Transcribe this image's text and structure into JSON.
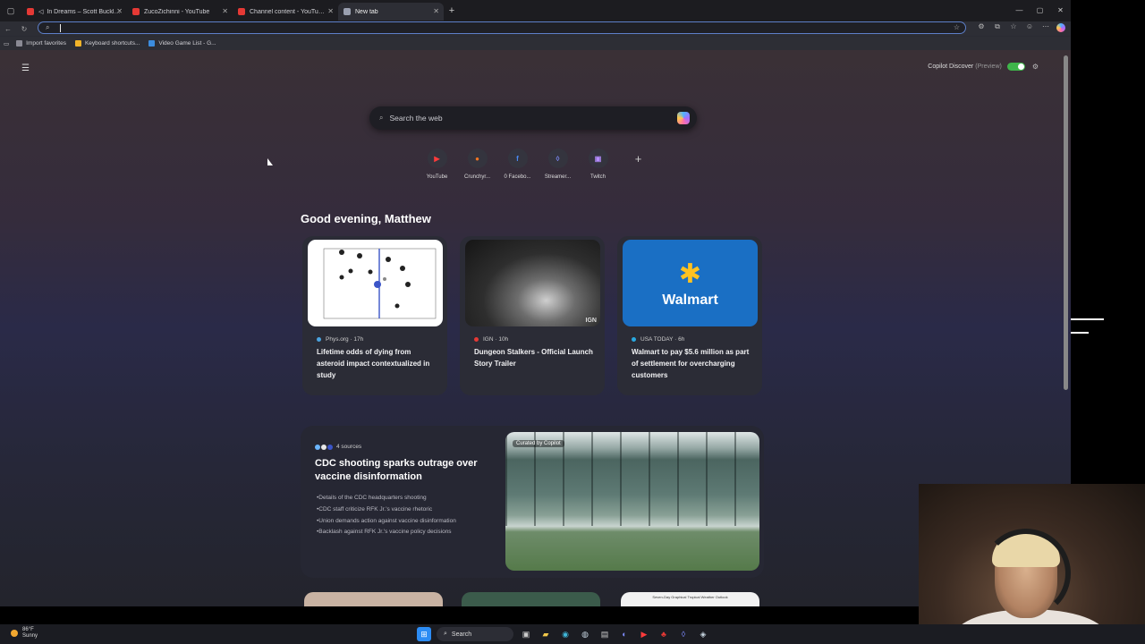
{
  "tabs": [
    {
      "label": "In Dreams – Scott Buckley (f",
      "color": "#e53935"
    },
    {
      "label": "ZucoZichinni - YouTube",
      "color": "#e53935"
    },
    {
      "label": "Channel content - YouTube Studio",
      "color": "#e53935"
    },
    {
      "label": "New tab",
      "color": "#9aa0b0"
    }
  ],
  "new_tab_symbol": "+",
  "bookmarks": [
    {
      "label": "Import favorites",
      "color": "#8a8a94"
    },
    {
      "label": "Keyboard shortcuts...",
      "color": "#f0b429"
    },
    {
      "label": "Video Game List - G...",
      "color": "#3c8dde"
    }
  ],
  "page": {
    "discover_label": "Copilot Discover",
    "discover_preview": "(Preview)",
    "search_placeholder": "Search the web",
    "greeting": "Good evening, Matthew"
  },
  "shortcuts": [
    {
      "label": "YouTube",
      "glyph": "▶",
      "color": "#ff3b3b"
    },
    {
      "label": "Crunchyr...",
      "glyph": "●",
      "color": "#f47521"
    },
    {
      "label": "0 Facebo...",
      "glyph": "f",
      "color": "#4b8cf7"
    },
    {
      "label": "Streamer...",
      "glyph": "◊",
      "color": "#7f8cff"
    },
    {
      "label": "Twitch",
      "glyph": "▣",
      "color": "#b58cff"
    }
  ],
  "cards": [
    {
      "source": "Phys.org · 17h",
      "title": "Lifetime odds of dying from asteroid impact contextualized in study",
      "dot": "#4aa3df"
    },
    {
      "source": "IGN · 10h",
      "title": "Dungeon Stalkers - Official Launch Story Trailer",
      "dot": "#e53935"
    },
    {
      "source": "USA TODAY · 6h",
      "title": "Walmart to pay $5.6 million as part of settlement for overcharging customers",
      "dot": "#29a8e0"
    }
  ],
  "walmart_logo_text": "Walmart",
  "feature": {
    "sources": "4 sources",
    "headline": "CDC shooting sparks outrage over vaccine disinformation",
    "curated": "Curated by Copilot",
    "bullets": [
      "•Details of the CDC headquarters shooting",
      "•CDC staff criticize RFK Jr.'s vaccine rhetoric",
      "•Union demands action against vaccine disinformation",
      "•Backlash against RFK Jr.'s vaccine policy decisions"
    ]
  },
  "peek_card_caption": "Seven-Day Graphical Tropical Weather Outlook",
  "taskbar": {
    "temperature": "86°F",
    "condition": "Sunny",
    "search_label": "Search"
  }
}
